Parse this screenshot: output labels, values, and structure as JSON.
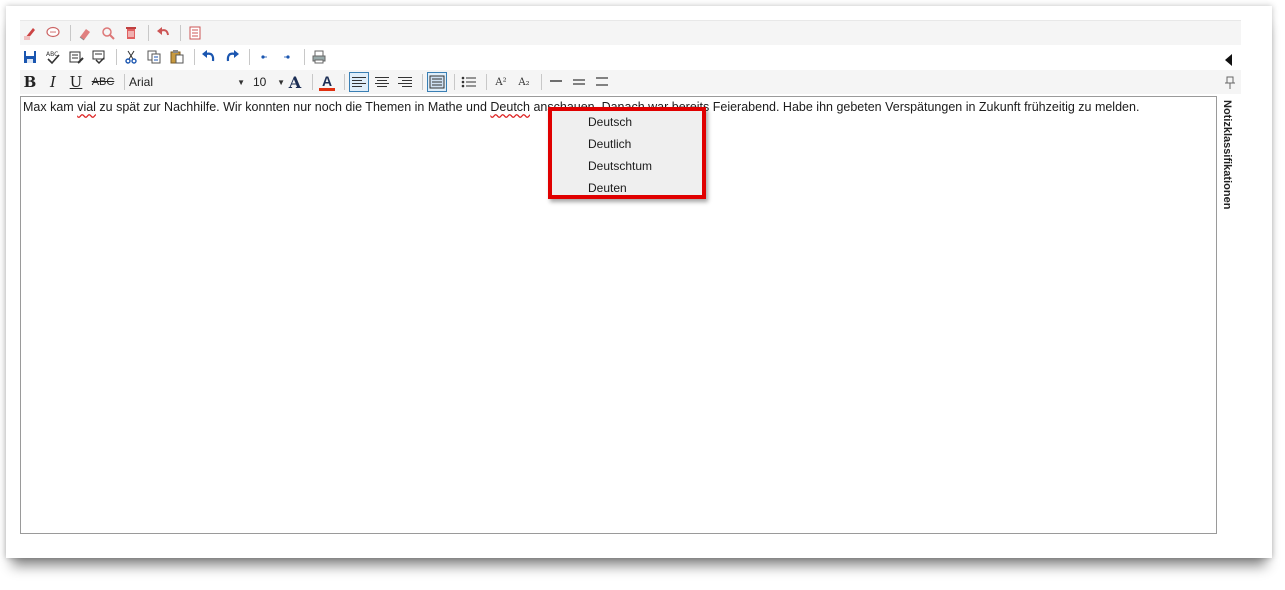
{
  "toolbar_top": {
    "icons": [
      "pen-note-icon",
      "speech-bubble-icon",
      "eraser-icon",
      "magnifier-icon",
      "trash-icon",
      "undo-arrow-icon",
      "document-icon"
    ]
  },
  "toolbar_main": {
    "icons": [
      "save-icon",
      "spellcheck-icon",
      "edit-doc-icon",
      "check-doc-icon",
      "cut-icon",
      "copy-icon",
      "paste-icon",
      "undo-icon",
      "redo-icon",
      "dot-left-icon",
      "dot-right-icon",
      "print-icon"
    ]
  },
  "format_bar": {
    "bold": "B",
    "italic": "I",
    "underline": "U",
    "strike": "ABC",
    "font_name": "Arial",
    "font_size": "10",
    "grow_font": "A",
    "font_color": "A",
    "superscript": "A²",
    "subscript": "A₂",
    "colors": {
      "font_color_bar": "#e03010",
      "active_border": "#3a7fb4"
    }
  },
  "editor": {
    "text_before": "Max kam ",
    "misspelled_1": "vial",
    "text_mid": " zu spät zur Nachhilfe. Wir konnten nur noch die Themen in Mathe und ",
    "misspelled_2": "Deutch",
    "text_hidden_1": " anschauen. Danach war bereits Feierabend. Habe ihn gebeten Verspätungen in Zukunft frühzeitig zu melden."
  },
  "context_menu": {
    "items": [
      "Deutsch",
      "Deutlich",
      "Deutschtum",
      "Deuten"
    ],
    "highlight_color": "#e00000"
  },
  "side_panel": {
    "label": "Notizklassifikationen",
    "icons": [
      "collapse-arrow-icon",
      "pin-icon"
    ]
  }
}
